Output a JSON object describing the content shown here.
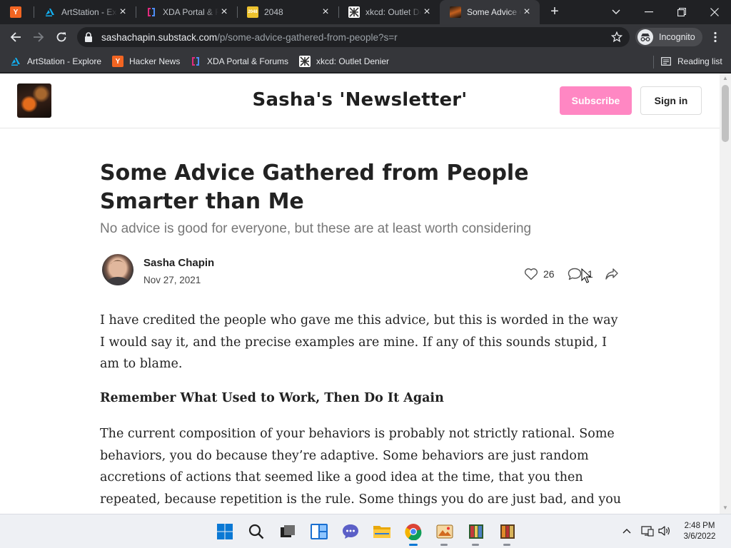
{
  "browser": {
    "tabs": [
      {
        "title": "",
        "favicon": "hacker-news-favicon",
        "active": false
      },
      {
        "title": "ArtStation - Explore",
        "favicon": "artstation-favicon",
        "active": false
      },
      {
        "title": "XDA Portal & Forums",
        "favicon": "xda-favicon",
        "active": false
      },
      {
        "title": "2048",
        "favicon": "2048-favicon",
        "active": false
      },
      {
        "title": "xkcd: Outlet Denier",
        "favicon": "xkcd-favicon",
        "active": false
      },
      {
        "title": "Some Advice Gathered from People Smarter than Me",
        "favicon": "substack-avatar-favicon",
        "active": true
      }
    ],
    "url_host": "sashachapin.substack.com",
    "url_path": "/p/some-advice-gathered-from-people?s=r",
    "incognito_label": "Incognito",
    "bookmarks": [
      {
        "label": "ArtStation - Explore",
        "favicon": "artstation-favicon"
      },
      {
        "label": "Hacker News",
        "favicon": "hacker-news-favicon"
      },
      {
        "label": "XDA Portal & Forums",
        "favicon": "xda-favicon"
      },
      {
        "label": "xkcd: Outlet Denier",
        "favicon": "xkcd-favicon"
      }
    ],
    "reading_list_label": "Reading list"
  },
  "site": {
    "title": "Sasha's 'Newsletter'",
    "subscribe_label": "Subscribe",
    "signin_label": "Sign in",
    "accent_color": "#ff87c3"
  },
  "post": {
    "title": "Some Advice Gathered from People Smarter than Me",
    "subtitle": "No advice is good for everyone, but these are at least worth considering",
    "author": "Sasha Chapin",
    "date": "Nov 27, 2021",
    "likes": "26",
    "comments": "1",
    "paragraph1": "I have credited the people who gave me this advice, but this is worded in the way I would say it, and the precise examples are mine. If any of this sounds stupid, I am to blame.",
    "heading1": "Remember What Used to Work, Then Do It Again",
    "paragraph2": "The current composition of your behaviors is probably not strictly rational. Some behaviors, you do because they’re adaptive. Some behaviors are just random accretions of actions that seemed like a good idea at the time, that you then repeated, because repetition is the rule. Some things you do are just bad, and you know they’re bad, but"
  },
  "taskbar": {
    "time": "2:48 PM",
    "date": "3/6/2022"
  }
}
